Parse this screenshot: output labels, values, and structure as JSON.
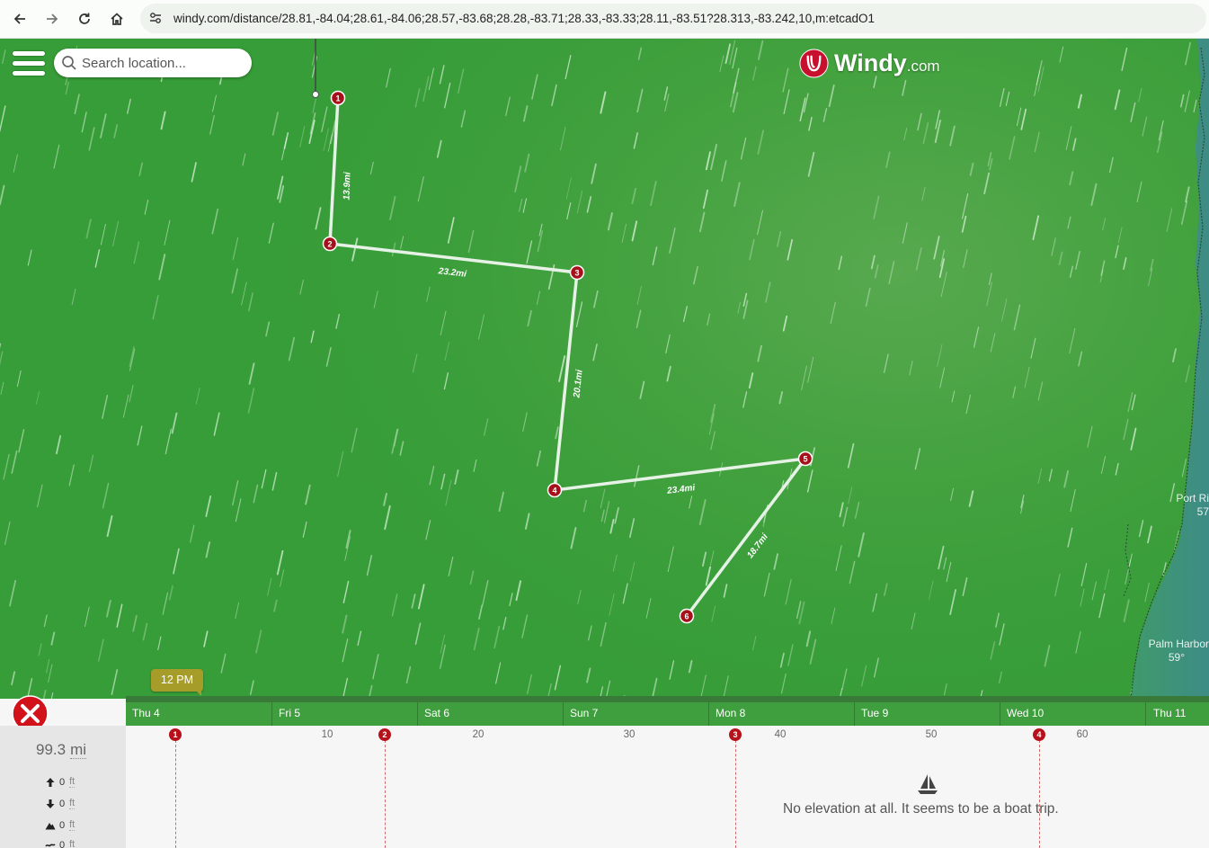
{
  "browser": {
    "url": "windy.com/distance/28.81,-84.04;28.61,-84.06;28.57,-83.68;28.28,-83.71;28.33,-83.33;28.11,-83.51?28.313,-83.242,10,m:etcadO1",
    "back_icon": "arrow-left-icon",
    "forward_icon": "arrow-right-icon",
    "reload_icon": "reload-icon",
    "home_icon": "home-icon"
  },
  "map": {
    "search_placeholder": "Search location...",
    "logo_text": "Windy",
    "logo_sub": ".com",
    "waypoints": [
      "1",
      "2",
      "3",
      "4",
      "5",
      "6"
    ],
    "segments": [
      "13.9mi",
      "23.2mi",
      "20.1mi",
      "23.4mi",
      "18.7mi"
    ],
    "places": [
      {
        "name": "Port Ri",
        "temp": "57"
      },
      {
        "name": "Palm Harbor",
        "temp": "59°"
      }
    ],
    "colors": {
      "accent": "#b5121b",
      "map_green": "#3a9e3a",
      "route": "#e6f2e6"
    }
  },
  "timeline": {
    "current_time": "12 PM",
    "days": [
      "Thu 4",
      "Fri 5",
      "Sat 6",
      "Sun 7",
      "Mon 8",
      "Tue 9",
      "Wed 10",
      "Thu 11"
    ]
  },
  "elevation": {
    "total_value": "99.3",
    "total_unit": "mi",
    "ascent": {
      "value": "0",
      "unit": "ft"
    },
    "descent": {
      "value": "0",
      "unit": "ft"
    },
    "max": {
      "value": "0",
      "unit": "ft"
    },
    "min": {
      "value": "0",
      "unit": "ft"
    },
    "mile_ticks": [
      "10",
      "20",
      "30",
      "40",
      "50",
      "60"
    ],
    "waypoint_markers": [
      "1",
      "2",
      "3",
      "4"
    ],
    "message": "No elevation at all. It seems to be a boat trip."
  }
}
